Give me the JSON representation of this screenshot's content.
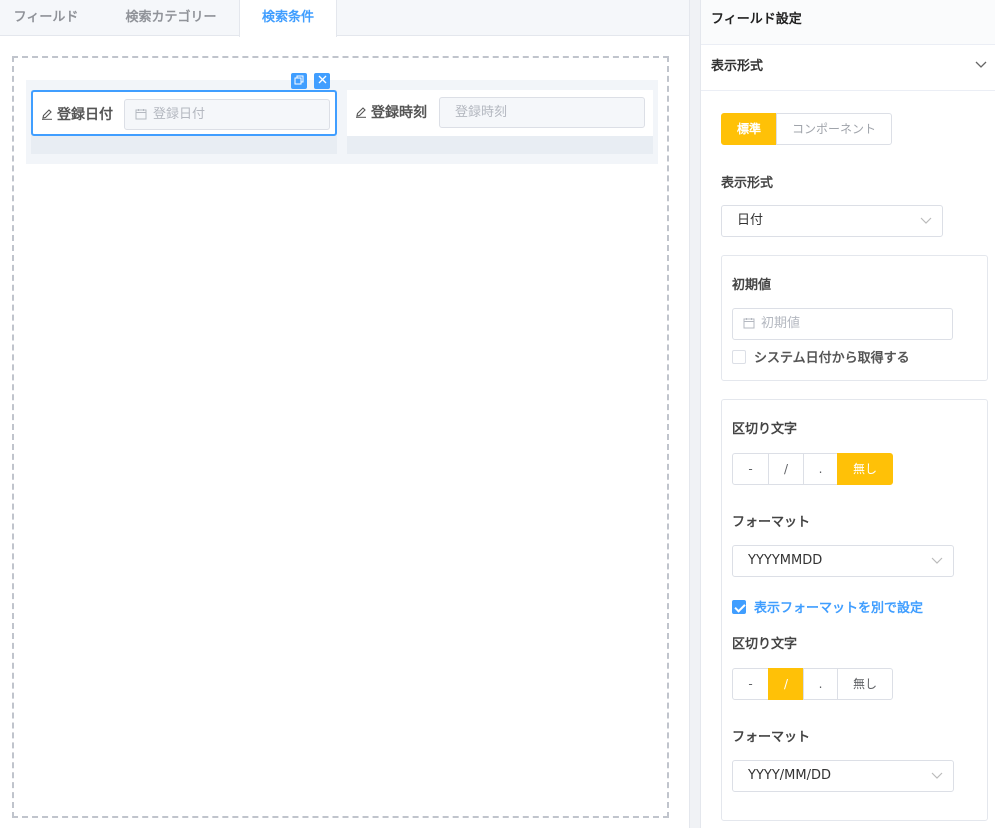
{
  "tabs": [
    {
      "label": "フィールド"
    },
    {
      "label": "検索カテゴリー"
    },
    {
      "label": "検索条件"
    }
  ],
  "active_tab": "検索条件",
  "canvas": {
    "fields": [
      {
        "label": "登録日付",
        "placeholder": "登録日付",
        "selected": true
      },
      {
        "label": "登録時刻",
        "placeholder": "登録時刻",
        "selected": false
      }
    ]
  },
  "panel": {
    "title": "フィールド設定",
    "collapse_label": "表示形式",
    "mode_options": [
      "標準",
      "コンポーネント"
    ],
    "mode_selected": "標準",
    "display_format_label": "表示形式",
    "display_format_value": "日付",
    "initial_value": {
      "label": "初期値",
      "placeholder": "初期値",
      "system_date_label": "システム日付から取得する",
      "system_date_checked": false
    },
    "separator_label": "区切り文字",
    "separator_options": [
      "-",
      "/",
      ".",
      "無し"
    ],
    "separator_selected": "無し",
    "format_label": "フォーマット",
    "format_value": "YYYYMMDD",
    "separate_display_label": "表示フォーマットを別で設定",
    "separate_display_checked": true,
    "display_separator_label": "区切り文字",
    "display_separator_selected": "/",
    "display_format_label2": "フォーマット",
    "display_format_value2": "YYYY/MM/DD"
  },
  "colors": {
    "accent": "#ffc107",
    "primary": "#409eff"
  }
}
